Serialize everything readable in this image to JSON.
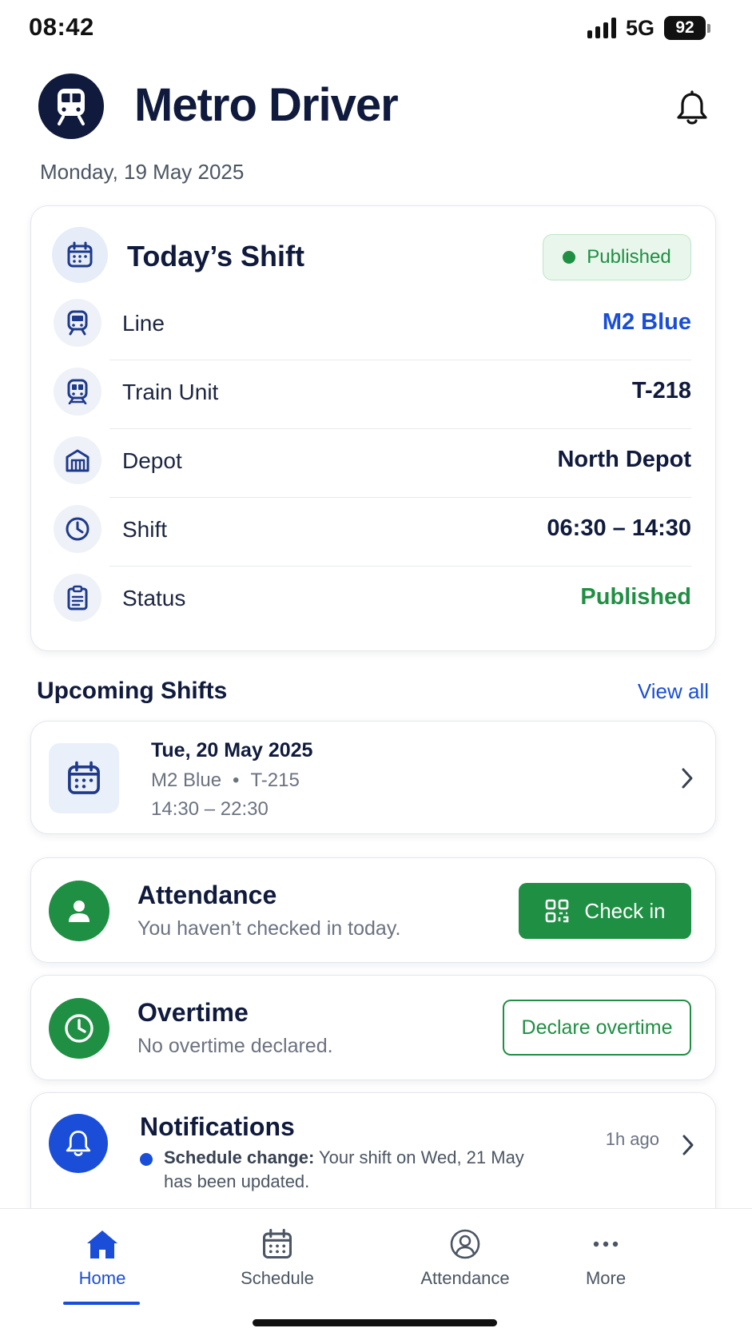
{
  "status_bar": {
    "time": "08:42",
    "network": "5G",
    "battery": "92"
  },
  "header": {
    "title": "Metro Driver",
    "date": "Monday, 19 May 2025"
  },
  "today_shift": {
    "title": "Today’s Shift",
    "badge": "Published",
    "rows": [
      {
        "label": "Line",
        "value": "M2 Blue",
        "icon": "train-icon"
      },
      {
        "label": "Train Unit",
        "value": "T-218",
        "icon": "train-unit-icon"
      },
      {
        "label": "Depot",
        "value": "North Depot",
        "icon": "depot-icon"
      },
      {
        "label": "Shift",
        "value": "06:30 – 14:30",
        "icon": "clock-icon"
      },
      {
        "label": "Status",
        "value": "Published",
        "icon": "clipboard-icon"
      }
    ]
  },
  "upcoming": {
    "title": "Upcoming Shifts",
    "view_all": "View all",
    "items": [
      {
        "date": "Tue, 20 May 2025",
        "line": "M2 Blue",
        "separator": "•",
        "unit": "T-215",
        "time": "14:30 – 22:30"
      }
    ]
  },
  "attendance": {
    "title": "Attendance",
    "subtitle": "You haven’t checked in today.",
    "button": "Check in"
  },
  "overtime": {
    "title": "Overtime",
    "subtitle": "No overtime declared.",
    "button": "Declare overtime"
  },
  "notifications": {
    "title": "Notifications",
    "time": "1h ago",
    "item_bold": "Schedule change:",
    "item_text": " Your shift on Wed, 21 May has been updated."
  },
  "bottom_nav": {
    "items": [
      {
        "label": "Home",
        "active": true
      },
      {
        "label": "Schedule",
        "active": false
      },
      {
        "label": "Attendance",
        "active": false
      },
      {
        "label": "More",
        "active": false
      }
    ]
  },
  "colors": {
    "navy": "#0f1a3d",
    "blue": "#1a4ed8",
    "green": "#1f8f43"
  }
}
